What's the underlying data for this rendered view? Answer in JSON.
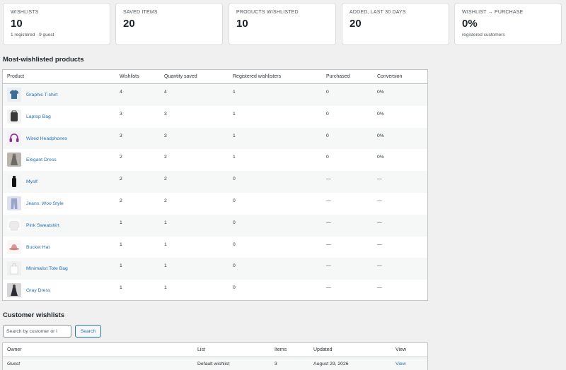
{
  "stats": [
    {
      "label": "WISHLISTS",
      "value": "10",
      "sub": "1 registered · 9 guest"
    },
    {
      "label": "SAVED ITEMS",
      "value": "20",
      "sub": ""
    },
    {
      "label": "PRODUCTS WISHLISTED",
      "value": "10",
      "sub": ""
    },
    {
      "label": "ADDED, LAST 30 DAYS",
      "value": "20",
      "sub": ""
    },
    {
      "label": "WISHLIST → PURCHASE",
      "value": "0%",
      "sub": "registered customers"
    }
  ],
  "products_section": {
    "title": "Most-wishlisted products",
    "columns": [
      "Product",
      "Wishlists",
      "Quantity saved",
      "Registered wishlisters",
      "Purchased",
      "Conversion"
    ],
    "rows": [
      {
        "name": "Graphic T-shirt",
        "wishlists": "4",
        "qty": "4",
        "registered": "1",
        "purchased": "0",
        "conversion": "0%",
        "icon": "tshirt-icon"
      },
      {
        "name": "Laptop Bag",
        "wishlists": "3",
        "qty": "3",
        "registered": "1",
        "purchased": "0",
        "conversion": "0%",
        "icon": "bag-icon"
      },
      {
        "name": "Wired Headphones",
        "wishlists": "3",
        "qty": "3",
        "registered": "1",
        "purchased": "0",
        "conversion": "0%",
        "icon": "headphones-icon"
      },
      {
        "name": "Elegant Dress",
        "wishlists": "2",
        "qty": "2",
        "registered": "1",
        "purchased": "0",
        "conversion": "0%",
        "icon": "dress-icon"
      },
      {
        "name": "Myslf",
        "wishlists": "2",
        "qty": "2",
        "registered": "0",
        "purchased": "—",
        "conversion": "—",
        "icon": "bottle-icon"
      },
      {
        "name": "Jeans: Woo Style",
        "wishlists": "2",
        "qty": "2",
        "registered": "0",
        "purchased": "—",
        "conversion": "—",
        "icon": "jeans-icon"
      },
      {
        "name": "Pink Sweatshirt",
        "wishlists": "1",
        "qty": "1",
        "registered": "0",
        "purchased": "—",
        "conversion": "—",
        "icon": "sweatshirt-icon"
      },
      {
        "name": "Bucket Hat",
        "wishlists": "1",
        "qty": "1",
        "registered": "0",
        "purchased": "—",
        "conversion": "—",
        "icon": "hat-icon"
      },
      {
        "name": "Minimalist Tote Bag",
        "wishlists": "1",
        "qty": "1",
        "registered": "0",
        "purchased": "—",
        "conversion": "—",
        "icon": "tote-icon"
      },
      {
        "name": "Gray Dress",
        "wishlists": "1",
        "qty": "1",
        "registered": "0",
        "purchased": "—",
        "conversion": "—",
        "icon": "gray-dress-icon"
      }
    ]
  },
  "wishlists_section": {
    "title": "Customer wishlists",
    "search_placeholder": "Search by customer or l",
    "search_button": "Search",
    "columns": [
      "Owner",
      "List",
      "Items",
      "Updated",
      "View"
    ],
    "rows": [
      {
        "owner": "Guest",
        "list": "Default wishlist",
        "items": "3",
        "updated": "August 29, 2026",
        "view": "View"
      }
    ]
  },
  "colors": {
    "link": "#2271b1",
    "border": "#c3c4c7",
    "background": "#f0f0f1"
  }
}
